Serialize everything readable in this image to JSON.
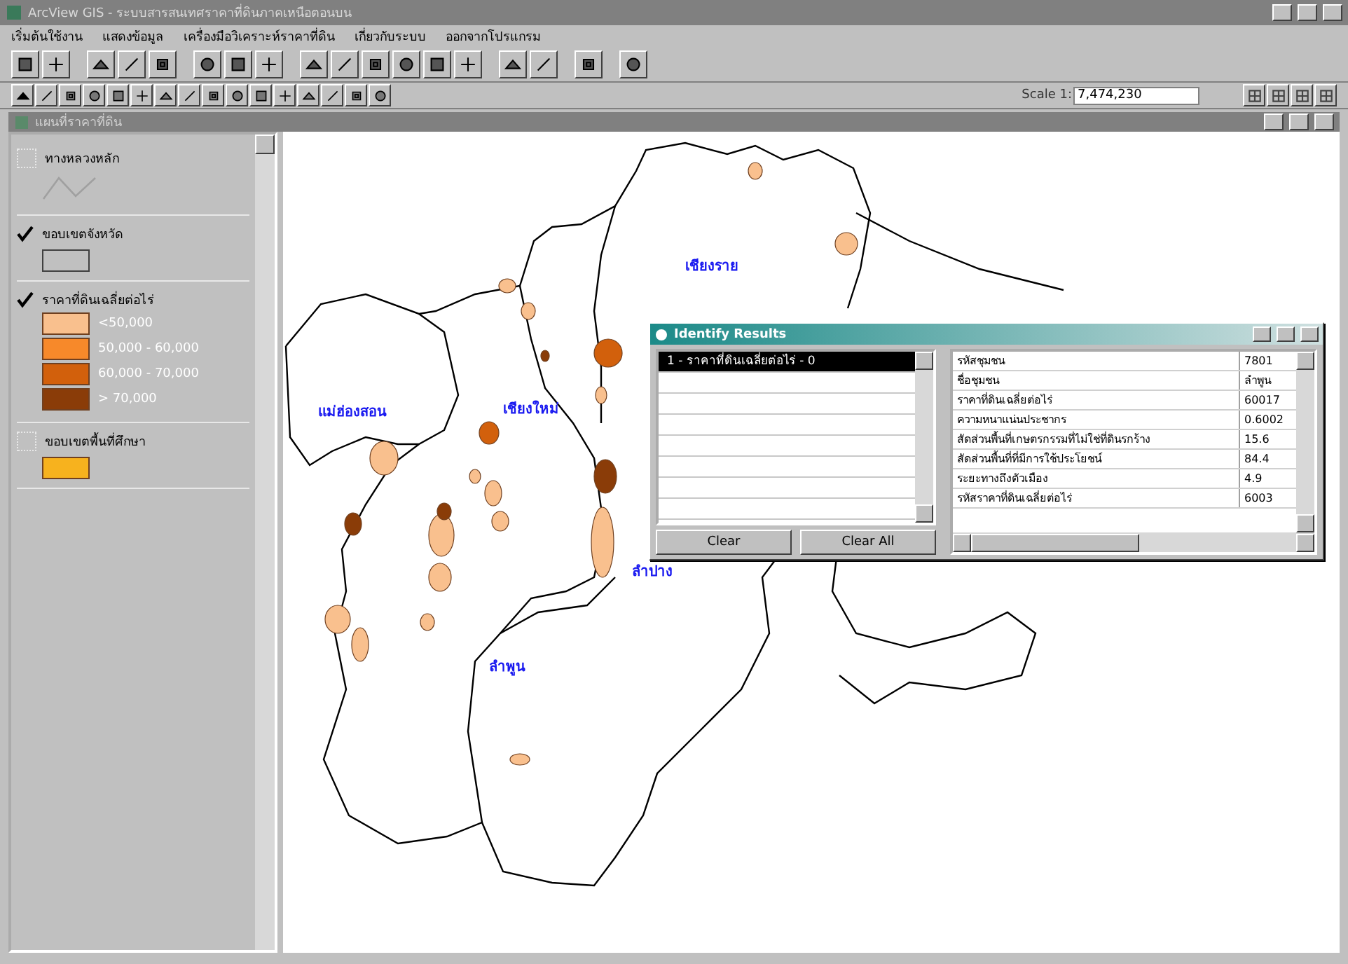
{
  "window": {
    "title": "ArcView GIS - ระบบสารสนเทศราคาที่ดินภาคเหนือตอนบน"
  },
  "menu": [
    "เริ่มต้นใช้งาน",
    "แสดงข้อมูล",
    "เครื่องมือวิเคราะห์ราคาที่ดิน",
    "เกี่ยวกับระบบ",
    "ออกจากโปรแกรม"
  ],
  "scale": {
    "label": "Scale 1:",
    "value": "7,474,230"
  },
  "view_window": {
    "title": "แผนที่ราคาที่ดิน"
  },
  "legend": [
    {
      "kind": "line",
      "label": "ทางหลวงหลัก",
      "checked": false
    },
    {
      "kind": "outline",
      "label": "ขอบเขตจังหวัด",
      "checked": true
    },
    {
      "kind": "classes",
      "label": "ราคาที่ดินเฉลี่ยต่อไร่",
      "checked": true,
      "classes": [
        {
          "label": "<50,000",
          "color": "#f9c08e"
        },
        {
          "label": "50,000 - 60,000",
          "color": "#f7892a"
        },
        {
          "label": "60,000 - 70,000",
          "color": "#d2600c"
        },
        {
          "label": "> 70,000",
          "color": "#8a3c08"
        }
      ]
    },
    {
      "kind": "fill",
      "label": "ขอบเขตพื้นที่ศึกษา",
      "checked": false,
      "color": "#f7b21e"
    }
  ],
  "map": {
    "labels": [
      "เชียงราย",
      "แม่ฮ่องสอน",
      "เชียงใหม่",
      "ลำปาง",
      "ลำพูน"
    ]
  },
  "identify": {
    "title": "Identify Results",
    "results": [
      {
        "text": "1 - ราคาที่ดินเฉลี่ยต่อไร่ - 0",
        "selected": true
      }
    ],
    "buttons": [
      "Clear",
      "Clear All"
    ],
    "attributes": [
      {
        "field": "รหัสชุมชน",
        "value": "7801"
      },
      {
        "field": "ชื่อชุมชน",
        "value": "ลำพูน"
      },
      {
        "field": "ราคาที่ดินเฉลี่ยต่อไร่",
        "value": "60017"
      },
      {
        "field": "ความหนาแน่นประชากร",
        "value": "0.6002"
      },
      {
        "field": "สัดส่วนพื้นที่เกษตรกรรมที่ไม่ใช่ที่ดินรกร้าง",
        "value": "15.6"
      },
      {
        "field": "สัดส่วนพื้นที่ที่มีการใช้ประโยชน์",
        "value": "84.4"
      },
      {
        "field": "ระยะทางถึงตัวเมือง",
        "value": "4.9"
      },
      {
        "field": "รหัสราคาที่ดินเฉลี่ยต่อไร่",
        "value": "6003"
      }
    ]
  }
}
